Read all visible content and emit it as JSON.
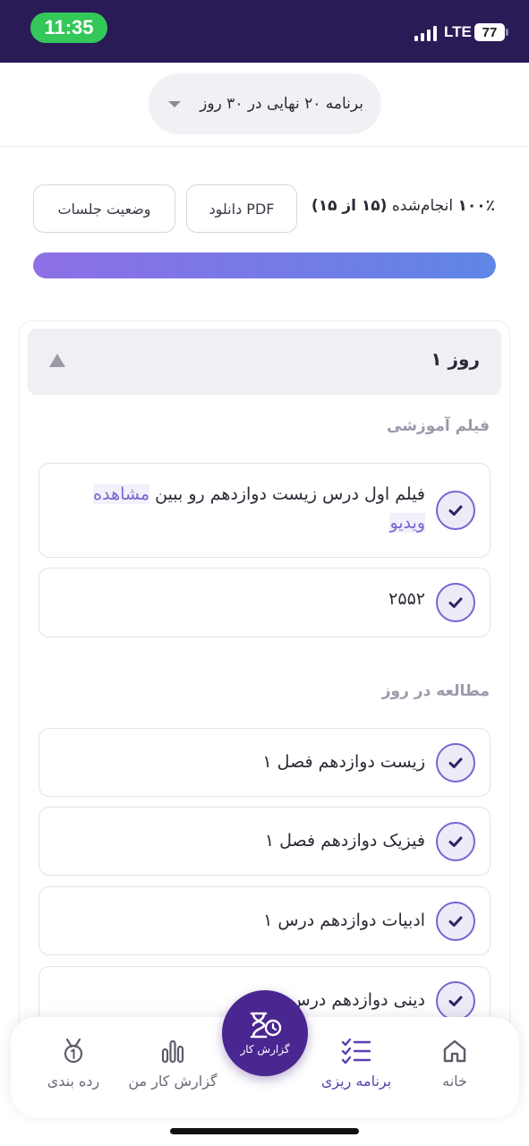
{
  "status_bar": {
    "time": "11:35",
    "network": "LTE",
    "battery": "77"
  },
  "plan_selector": {
    "label": "برنامه ۲۰ نهایی در ۳۰ روز"
  },
  "progress": {
    "percent_label": "۱۰۰٪",
    "done_label": "انجام‌شده",
    "count_label": "(۱۵ از ۱۵)",
    "fraction": 1.0,
    "download_pdf": "دانلود PDF",
    "sessions_status": "وضعیت جلسات"
  },
  "day": {
    "title": "روز ۱",
    "sections": [
      {
        "label": "فیلم آموزشی",
        "tasks": [
          {
            "text": "فیلم اول درس زیست دوازدهم رو ببین",
            "link": "مشاهده ویدیو"
          },
          {
            "text": "۲۵۵۲"
          }
        ]
      },
      {
        "label": "مطالعه در روز",
        "tasks": [
          {
            "text": "زیست دوازدهم فصل ۱"
          },
          {
            "text": "فیزیک دوازدهم فصل ۱"
          },
          {
            "text": "ادبیات دوازدهم درس ۱"
          },
          {
            "text": "دینی دوازدهم درس"
          }
        ]
      }
    ]
  },
  "bottom_nav": {
    "home": "خانه",
    "plan": "برنامه ریزی",
    "report_action": "گزارش کار",
    "my_report": "گزارش کار من",
    "ranking": "رده بندی"
  },
  "colors": {
    "status_bar_bg": "#2a1b57",
    "accent": "#7a63d3",
    "fab_bg": "#4a2691",
    "time_pill": "#34c759"
  }
}
